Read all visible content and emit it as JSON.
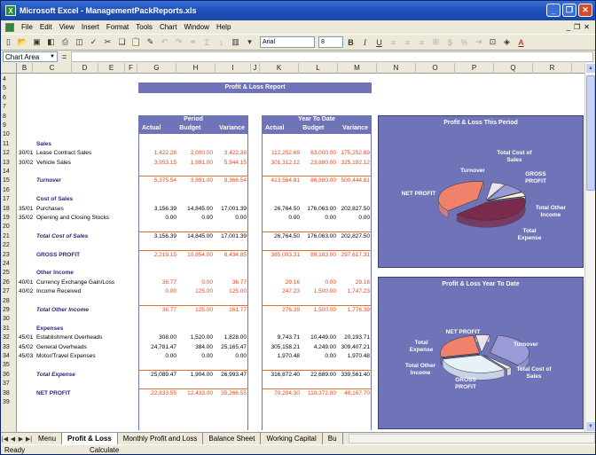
{
  "window": {
    "title": "Microsoft Excel - ManagementPackReports.xls"
  },
  "menu": [
    "File",
    "Edit",
    "View",
    "Insert",
    "Format",
    "Tools",
    "Chart",
    "Window",
    "Help"
  ],
  "toolbar": {
    "font": "Arial",
    "size": "8"
  },
  "formula_bar": {
    "name_box": "Chart Area",
    "fx": "="
  },
  "columns": [
    "B",
    "C",
    "D",
    "E",
    "F",
    "G",
    "H",
    "I",
    "J",
    "K",
    "L",
    "M",
    "N",
    "O",
    "P",
    "Q",
    "R",
    "S",
    "T",
    "U"
  ],
  "rows": [
    "4",
    "5",
    "6",
    "7",
    "8",
    "9",
    "10",
    "11",
    "12",
    "13",
    "14",
    "15",
    "16",
    "17",
    "18",
    "19",
    "20",
    "21",
    "22",
    "23",
    "24",
    "25",
    "26",
    "27",
    "28",
    "29",
    "30",
    "31",
    "32",
    "33",
    "34",
    "35",
    "36",
    "37",
    "38",
    "39"
  ],
  "report": {
    "title": "Profit & Loss Report",
    "period": "Period",
    "ytd": "Year To Date",
    "h_actual": "Actual",
    "h_budget": "Budget",
    "h_variance": "Variance"
  },
  "lines": [
    {
      "label": "Sales",
      "bold": true,
      "navy": true
    },
    {
      "code": "30/01",
      "label": "Lease Contract Sales",
      "p": [
        "1,422.28",
        "2,000.00",
        "3,422.38"
      ],
      "y": [
        "112,252.69",
        "63,000.00",
        "175,252.69"
      ],
      "red": true
    },
    {
      "code": "30/02",
      "label": "Vehicle Sales",
      "p": [
        "3,953.15",
        "1,991.00",
        "5,944.15"
      ],
      "y": [
        "301,312.12",
        "23,880.00",
        "325,192.12"
      ],
      "red": true
    },
    {
      "label": "Turnover",
      "bold": true,
      "it": true,
      "navy": true,
      "p": [
        "5,375.54",
        "3,991.00",
        "9,366.54"
      ],
      "y": [
        "413,564.81",
        "86,880.00",
        "500,444.81"
      ],
      "red": true,
      "top": true
    },
    {
      "label": "Cost of Sales",
      "bold": true,
      "navy": true
    },
    {
      "code": "35/01",
      "label": "Purchases",
      "p": [
        "3,156.39",
        "14,845.00",
        "17,001.39"
      ],
      "y": [
        "26,764.50",
        "176,063.00",
        "202,827.50"
      ]
    },
    {
      "code": "35/02",
      "label": "Opening and Closing Stocks",
      "p": [
        "0.00",
        "0.00",
        "0.00"
      ],
      "y": [
        "0.00",
        "0.00",
        "0.00"
      ]
    },
    {
      "label": "Total Cost of Sales",
      "bold": true,
      "it": true,
      "navy": true,
      "p": [
        "3,156.39",
        "14,845.00",
        "17,001.39"
      ],
      "y": [
        "26,764.50",
        "176,063.00",
        "202,827.50"
      ],
      "top": true
    },
    {
      "label": "GROSS PROFIT",
      "bold": true,
      "navy": true,
      "p": [
        "2,219.15",
        "10,854.00",
        "8,434.85"
      ],
      "y": [
        "385,003.31",
        "89,183.00",
        "297,617.31"
      ],
      "red": true,
      "top": true
    },
    {
      "label": "Other Income",
      "bold": true,
      "navy": true
    },
    {
      "code": "40/01",
      "label": "Currency Exchange Gain/Loss",
      "p": [
        "36.77",
        "0.00",
        "36.77"
      ],
      "y": [
        "29.16",
        "0.00",
        "29.16"
      ],
      "red": true
    },
    {
      "code": "40/02",
      "label": "Income Received",
      "p": [
        "0.00",
        "125.00",
        "125.00"
      ],
      "y": [
        "247.23",
        "1,500.00",
        "1,747.23"
      ],
      "red": true
    },
    {
      "label": "Total Other Income",
      "bold": true,
      "it": true,
      "navy": true,
      "p": [
        "36.77",
        "125.00",
        "161.77"
      ],
      "y": [
        "276.39",
        "1,500.00",
        "1,776.39"
      ],
      "red": true,
      "top": true
    },
    {
      "label": "Expenses",
      "bold": true,
      "navy": true
    },
    {
      "code": "45/01",
      "label": "Establishment Overheads",
      "p": [
        "308.00",
        "1,520.00",
        "1,828.00"
      ],
      "y": [
        "9,743.71",
        "10,449.00",
        "20,193.71"
      ]
    },
    {
      "code": "45/02",
      "label": "General Overheads",
      "p": [
        "24,781.47",
        "384.00",
        "25,165.47"
      ],
      "y": [
        "305,158.21",
        "4,249.00",
        "309,407.21"
      ]
    },
    {
      "code": "45/03",
      "label": "Motor/Travel Expenses",
      "p": [
        "0.00",
        "0.00",
        "0.00"
      ],
      "y": [
        "1,970.48",
        "0.00",
        "1,970.48"
      ]
    },
    {
      "label": "Total Expense",
      "bold": true,
      "it": true,
      "navy": true,
      "p": [
        "25,089.47",
        "1,904.00",
        "26,993.47"
      ],
      "y": [
        "316,872.40",
        "22,689.00",
        "339,561.40"
      ],
      "top": true
    },
    {
      "label": "NET PROFIT",
      "bold": true,
      "navy": true,
      "p": [
        "22,833.55",
        "12,433.00",
        "35,266.55"
      ],
      "y": [
        "70,204.30",
        "110,372.00",
        "40,167.70"
      ],
      "red": true,
      "top": true
    }
  ],
  "chart_data": [
    {
      "type": "pie",
      "title": "Profit & Loss This Period",
      "labels": [
        "Total Cost of Sales",
        "Turnover",
        "GROSS PROFIT",
        "Total Other Income",
        "Total Expense",
        "NET PROFIT"
      ],
      "values": [
        3156.39,
        5375.54,
        2219.15,
        36.77,
        25089.47,
        22833.55
      ]
    },
    {
      "type": "pie",
      "title": "Profit & Loss Year To Date",
      "labels": [
        "NET PROFIT",
        "Turnover",
        "Total Cost of Sales",
        "GROSS PROFIT",
        "Total Other Income",
        "Total Expense"
      ],
      "values": [
        70204.3,
        413564.81,
        26764.5,
        385003.31,
        276.39,
        316872.4
      ]
    }
  ],
  "sheet_tabs": [
    "Menu",
    "Profit & Loss",
    "Monthly Profit and Loss",
    "Balance Sheet",
    "Working Capital",
    "Bu"
  ],
  "status": {
    "ready": "Ready",
    "calc": "Calculate"
  }
}
